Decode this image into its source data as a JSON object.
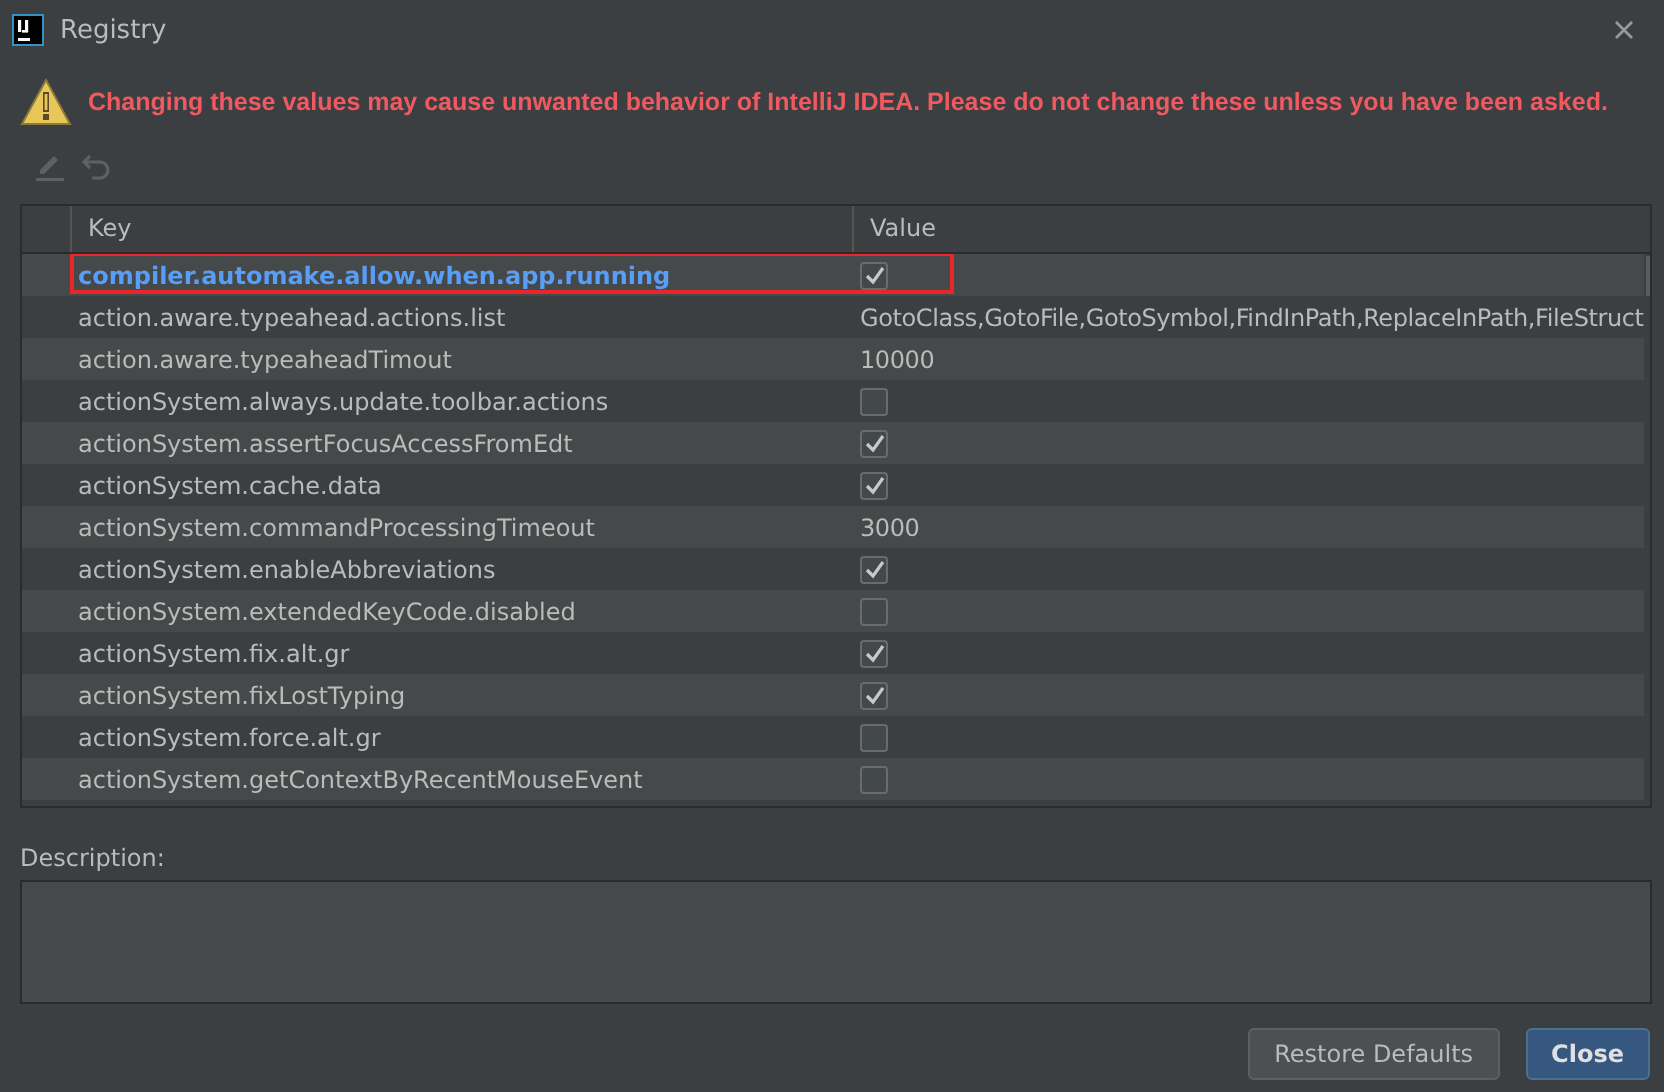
{
  "window": {
    "title": "Registry"
  },
  "warning": "Changing these values may cause unwanted behavior of IntelliJ IDEA. Please do not change these unless you have been asked.",
  "toolbar": [
    {
      "kind": "edit",
      "disabled": true
    },
    {
      "kind": "revert",
      "disabled": true
    }
  ],
  "table": {
    "columns": [
      "Key",
      "Value"
    ],
    "rows": [
      {
        "key": "compiler.automake.allow.when.app.running",
        "kind": "checkbox",
        "checked": true,
        "selected": true,
        "outlined": true
      },
      {
        "key": "action.aware.typeahead.actions.list",
        "kind": "text",
        "value": "GotoClass,GotoFile,GotoSymbol,FindInPath,ReplaceInPath,FileStruct",
        "selected": false,
        "outlined": false
      },
      {
        "key": "action.aware.typeaheadTimout",
        "kind": "text",
        "value": "10000",
        "selected": false,
        "outlined": false
      },
      {
        "key": "actionSystem.always.update.toolbar.actions",
        "kind": "checkbox",
        "checked": false,
        "selected": false,
        "outlined": false
      },
      {
        "key": "actionSystem.assertFocusAccessFromEdt",
        "kind": "checkbox",
        "checked": true,
        "selected": false,
        "outlined": false
      },
      {
        "key": "actionSystem.cache.data",
        "kind": "checkbox",
        "checked": true,
        "selected": false,
        "outlined": false
      },
      {
        "key": "actionSystem.commandProcessingTimeout",
        "kind": "text",
        "value": "3000",
        "selected": false,
        "outlined": false
      },
      {
        "key": "actionSystem.enableAbbreviations",
        "kind": "checkbox",
        "checked": true,
        "selected": false,
        "outlined": false
      },
      {
        "key": "actionSystem.extendedKeyCode.disabled",
        "kind": "checkbox",
        "checked": false,
        "selected": false,
        "outlined": false
      },
      {
        "key": "actionSystem.fix.alt.gr",
        "kind": "checkbox",
        "checked": true,
        "selected": false,
        "outlined": false
      },
      {
        "key": "actionSystem.fixLostTyping",
        "kind": "checkbox",
        "checked": true,
        "selected": false,
        "outlined": false
      },
      {
        "key": "actionSystem.force.alt.gr",
        "kind": "checkbox",
        "checked": false,
        "selected": false,
        "outlined": false
      },
      {
        "key": "actionSystem.getContextByRecentMouseEvent",
        "kind": "checkbox",
        "checked": false,
        "selected": false,
        "outlined": false
      }
    ]
  },
  "description": {
    "label": "Description:"
  },
  "buttons": [
    {
      "label": "Restore Defaults",
      "default": false
    },
    {
      "label": "Close",
      "default": true
    }
  ]
}
